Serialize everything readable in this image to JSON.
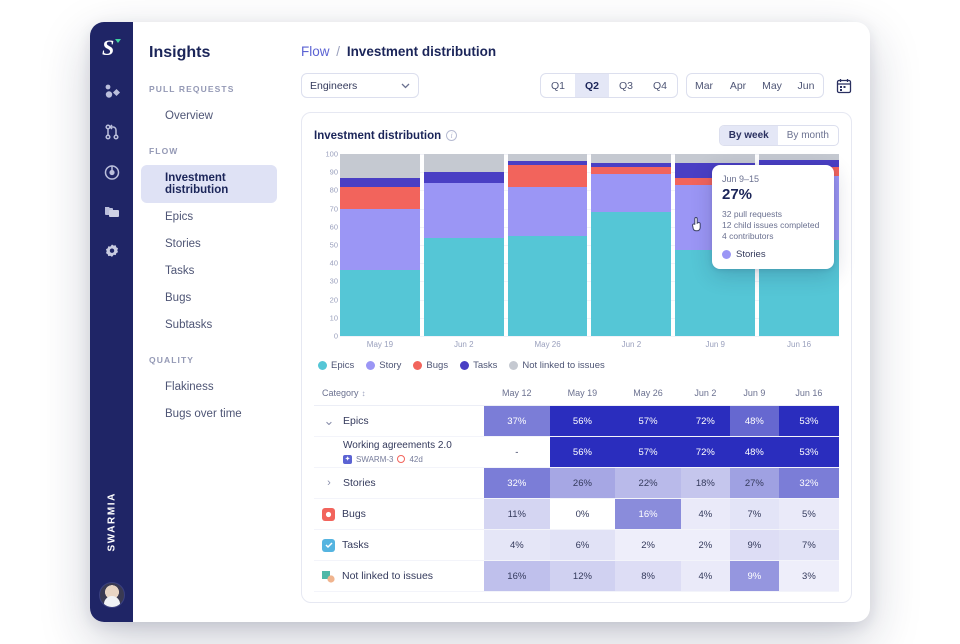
{
  "rail": {
    "logo": "swarmia-logo-icon",
    "icons": [
      "shapes-icon",
      "pull-request-icon",
      "target-icon",
      "folders-icon",
      "gear-icon"
    ],
    "brand": "SWARMIA",
    "avatar": "user-avatar"
  },
  "nav": {
    "title": "Insights",
    "groups": [
      {
        "label": "PULL REQUESTS",
        "items": [
          {
            "label": "Overview",
            "active": false
          }
        ]
      },
      {
        "label": "FLOW",
        "items": [
          {
            "label": "Investment distribution",
            "active": true
          },
          {
            "label": "Epics",
            "active": false
          },
          {
            "label": "Stories",
            "active": false
          },
          {
            "label": "Tasks",
            "active": false
          },
          {
            "label": "Bugs",
            "active": false
          },
          {
            "label": "Subtasks",
            "active": false
          }
        ]
      },
      {
        "label": "QUALITY",
        "items": [
          {
            "label": "Flakiness",
            "active": false
          },
          {
            "label": "Bugs over time",
            "active": false
          }
        ]
      }
    ]
  },
  "breadcrumb": {
    "root": "Flow",
    "separator": "/",
    "leaf": "Investment distribution"
  },
  "controls": {
    "team_select": "Engineers",
    "quarters": [
      "Q1",
      "Q2",
      "Q3",
      "Q4"
    ],
    "quarter_selected": "Q2",
    "months": [
      "Mar",
      "Apr",
      "May",
      "Jun"
    ],
    "month_selected": "",
    "calendar_icon": "calendar-icon"
  },
  "card": {
    "title": "Investment distribution",
    "info_icon": "info-icon",
    "granularity": [
      "By week",
      "By month"
    ],
    "granularity_selected": "By week"
  },
  "tooltip": {
    "date": "Jun 9–15",
    "percent": "27%",
    "lines": [
      "32 pull requests",
      "12 child issues completed",
      "4 contributors"
    ],
    "series": "Stories",
    "series_color": "#9b96f5"
  },
  "chart_data": {
    "type": "bar",
    "title": "Investment distribution",
    "stacked": true,
    "normalized_percent": true,
    "xlabel": "",
    "ylabel": "",
    "ylim": [
      0,
      100
    ],
    "yticks": [
      0,
      10,
      20,
      30,
      40,
      50,
      60,
      70,
      80,
      90,
      100
    ],
    "grid": true,
    "legend_position": "bottom",
    "categories": [
      "May 19",
      "Jun 2",
      "May 26",
      "Jun 2",
      "Jun 9",
      "Jun 16"
    ],
    "series": [
      {
        "name": "Epics",
        "color": "#55c6d6",
        "values": [
          36,
          54,
          55,
          68,
          47,
          53
        ]
      },
      {
        "name": "Story",
        "color": "#9b96f5",
        "values": [
          34,
          30,
          27,
          21,
          36,
          35
        ]
      },
      {
        "name": "Bugs",
        "color": "#f2645c",
        "values": [
          12,
          0,
          12,
          4,
          4,
          5
        ]
      },
      {
        "name": "Tasks",
        "color": "#4a3fc4",
        "values": [
          5,
          6,
          2,
          2,
          8,
          4
        ]
      },
      {
        "name": "Not linked to issues",
        "color": "#c5c9d1",
        "values": [
          13,
          10,
          4,
          5,
          5,
          3
        ]
      }
    ],
    "legend": [
      {
        "label": "Epics",
        "color": "#55c6d6"
      },
      {
        "label": "Story",
        "color": "#9b96f5"
      },
      {
        "label": "Bugs",
        "color": "#f2645c"
      },
      {
        "label": "Tasks",
        "color": "#4a3fc4"
      },
      {
        "label": "Not linked to issues",
        "color": "#c5c9d1"
      }
    ]
  },
  "table": {
    "columns": [
      "Category",
      "May 12",
      "May 19",
      "May 26",
      "Jun 2",
      "Jun 9",
      "Jun 16"
    ],
    "sort_icon": "sort-icon",
    "rows": [
      {
        "kind": "group",
        "label": "Epics",
        "icon": "chevron-down-icon",
        "expanded": true,
        "values": [
          "37%",
          "56%",
          "57%",
          "72%",
          "48%",
          "53%"
        ],
        "intensities": [
          0.62,
          1.0,
          1.0,
          1.0,
          0.72,
          1.0
        ]
      },
      {
        "kind": "child",
        "label": "Working agreements 2.0",
        "issue_key": "SWARM-3",
        "issue_icon": "jira-epic-icon",
        "age": "42d",
        "age_icon": "clock-ring-icon",
        "values": [
          "-",
          "56%",
          "57%",
          "72%",
          "48%",
          "53%"
        ],
        "intensities": [
          0.0,
          1.0,
          1.0,
          1.0,
          1.0,
          1.0
        ]
      },
      {
        "kind": "group",
        "label": "Stories",
        "icon": "chevron-right-icon",
        "expanded": false,
        "values": [
          "32%",
          "26%",
          "22%",
          "18%",
          "27%",
          "32%"
        ],
        "intensities": [
          0.62,
          0.42,
          0.33,
          0.27,
          0.45,
          0.62
        ]
      },
      {
        "kind": "leaf",
        "label": "Bugs",
        "icon": "bug-square-icon",
        "icon_color": "#f2645c",
        "values": [
          "11%",
          "0%",
          "16%",
          "4%",
          "7%",
          "5%"
        ],
        "intensities": [
          0.2,
          0.0,
          0.55,
          0.1,
          0.13,
          0.1
        ]
      },
      {
        "kind": "leaf",
        "label": "Tasks",
        "icon": "task-check-icon",
        "icon_color": "#55b4e0",
        "values": [
          "4%",
          "6%",
          "2%",
          "2%",
          "9%",
          "7%"
        ],
        "intensities": [
          0.12,
          0.14,
          0.08,
          0.08,
          0.16,
          0.14
        ]
      },
      {
        "kind": "leaf",
        "label": "Not linked to issues",
        "icon": "unlinked-icon",
        "icon_color": "#4eb8a8",
        "values": [
          "16%",
          "12%",
          "8%",
          "4%",
          "9%",
          "3%"
        ],
        "intensities": [
          0.3,
          0.22,
          0.16,
          0.1,
          0.5,
          0.08
        ]
      }
    ]
  }
}
